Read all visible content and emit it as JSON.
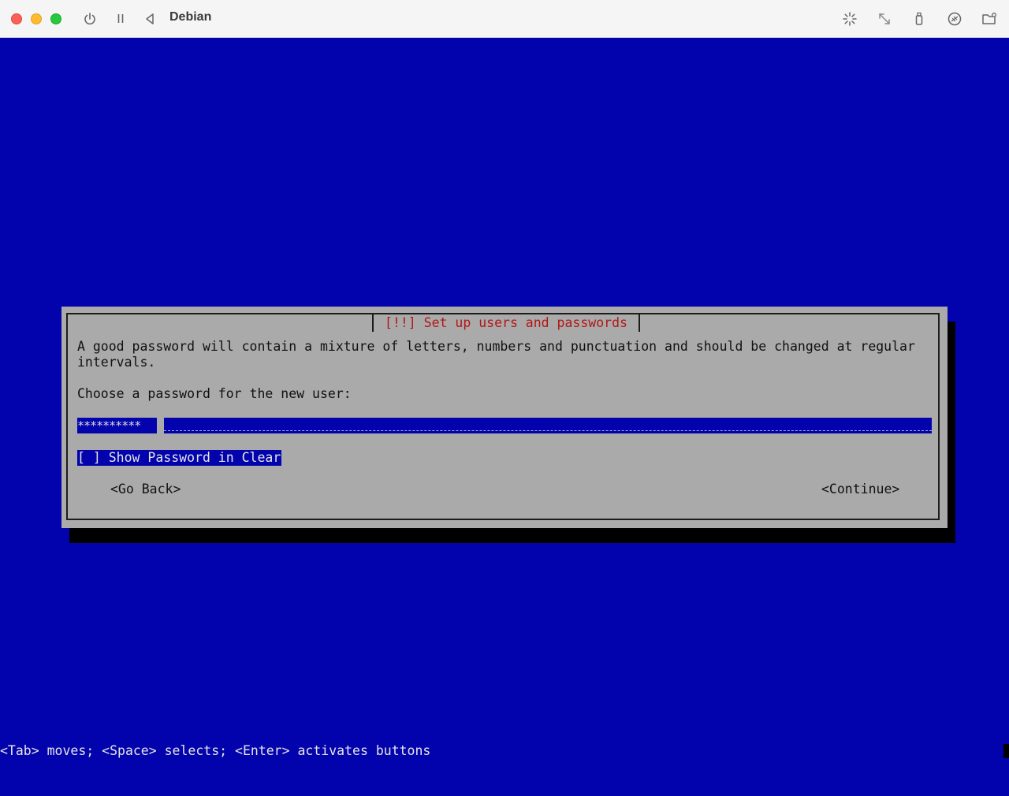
{
  "window": {
    "title": "Debian",
    "toolbar_icons": [
      "power-icon",
      "pause-icon",
      "back-icon",
      "brightness-icon",
      "resize-icon",
      "usb-icon",
      "network-icon",
      "shared-folder-icon"
    ]
  },
  "dialog": {
    "title": "[!!] Set up users and passwords",
    "description_line1": "A good password will contain a mixture of letters, numbers and punctuation and should be changed at regular",
    "description_line2": "intervals.",
    "prompt": "Choose a password for the new user:",
    "password_value": "**********",
    "show_password_checkbox": "[ ] Show Password in Clear",
    "go_back_button": "<Go Back>",
    "continue_button": "<Continue>"
  },
  "footer_hint": "<Tab> moves; <Space> selects; <Enter> activates buttons",
  "colors": {
    "background": "#0303ad",
    "dialog": "#aaaaaa",
    "title": "#b31616"
  }
}
